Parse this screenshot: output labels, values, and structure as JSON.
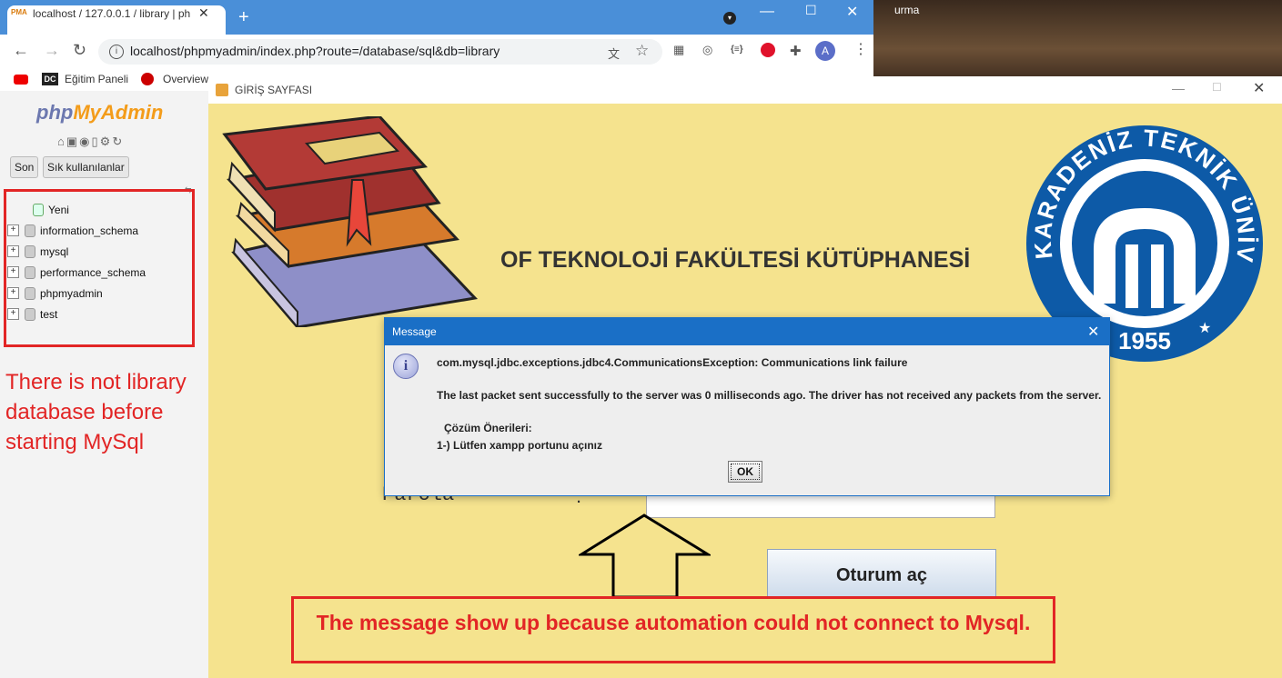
{
  "browser": {
    "tab_title": "localhost / 127.0.0.1 / library | ph",
    "tab_favicon": "PMA",
    "new_tab": "+",
    "url": "localhost/phpmyadmin/index.php?route=/database/sql&db=library",
    "avatar_letter": "A",
    "ext_code": "{≡}",
    "bookmarks": {
      "dc": "DC",
      "egitim": "Eğitim Paneli",
      "overview": "Overview"
    }
  },
  "desktop": {
    "partial_text": "urma"
  },
  "phpmyadmin": {
    "logo_php": "php",
    "logo_myadmin": "MyAdmin",
    "btn_recent": "Son",
    "btn_favorites": "Sık kullanılanlar",
    "tree": [
      {
        "label": "Yeni"
      },
      {
        "label": "information_schema"
      },
      {
        "label": "mysql"
      },
      {
        "label": "performance_schema"
      },
      {
        "label": "phpmyadmin"
      },
      {
        "label": "test"
      }
    ]
  },
  "annotation_left": "There is not library database before starting MySql",
  "annotation_bottom": "The message show up because automation could not connect to Mysql.",
  "login_window": {
    "title": "GİRİŞ SAYFASI",
    "heading": "OF TEKNOLOJİ FAKÜLTESİ KÜTÜPHANESİ",
    "password_label": "Parola",
    "colon": ":",
    "login_button": "Oturum aç",
    "logo_text_top": "KARADENİZ TEKNİK ÜNİVERSİTESİ",
    "logo_year": "1955"
  },
  "dialog": {
    "title": "Message",
    "line1": "com.mysql.jdbc.exceptions.jdbc4.CommunicationsException: Communications link failure",
    "line2": "The last packet sent successfully to the server was 0 milliseconds ago. The driver has not received any packets from the server.",
    "line3": "Çözüm Önerileri:",
    "line4": "1-) Lütfen xampp portunu açınız",
    "ok": "OK"
  },
  "colors": {
    "annotation_red": "#e22525",
    "login_bg": "#f5e38e",
    "dialog_title": "#1a6fc6",
    "ktu_blue": "#0d5aa7"
  }
}
